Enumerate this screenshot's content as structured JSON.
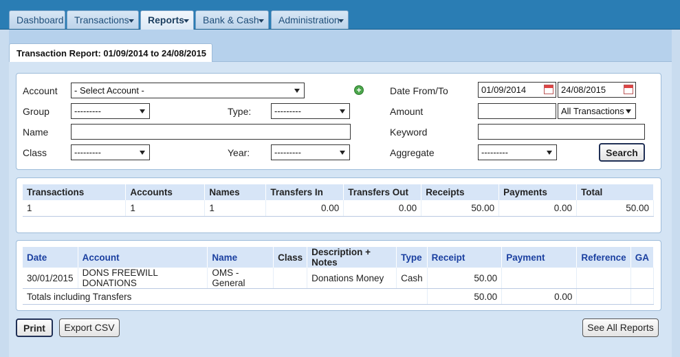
{
  "nav": {
    "tabs": [
      {
        "label": "Dashboard",
        "dropdown": false,
        "active": false
      },
      {
        "label": "Transactions",
        "dropdown": true,
        "active": false
      },
      {
        "label": "Reports",
        "dropdown": true,
        "active": true
      },
      {
        "label": "Bank & Cash",
        "dropdown": true,
        "active": false
      },
      {
        "label": "Administration",
        "dropdown": true,
        "active": false
      }
    ]
  },
  "report_tab": {
    "title": "Transaction Report: 01/09/2014 to 24/08/2015"
  },
  "filters": {
    "account_label": "Account",
    "account_value": "- Select Account -",
    "group_label": "Group",
    "group_value": "---------",
    "type_label": "Type:",
    "type_value": "---------",
    "name_label": "Name",
    "name_value": "",
    "class_label": "Class",
    "class_value": "---------",
    "year_label": "Year:",
    "year_value": "---------",
    "date_label": "Date From/To",
    "date_from": "01/09/2014",
    "date_to": "24/08/2015",
    "amount_label": "Amount",
    "amount_value": "",
    "amount_filter": "All Transactions",
    "keyword_label": "Keyword",
    "keyword_value": "",
    "aggregate_label": "Aggregate",
    "aggregate_value": "---------",
    "search_button": "Search"
  },
  "summary": {
    "headers": [
      "Transactions",
      "Accounts",
      "Names",
      "Transfers In",
      "Transfers Out",
      "Receipts",
      "Payments",
      "Total"
    ],
    "row": [
      "1",
      "1",
      "1",
      "0.00",
      "0.00",
      "50.00",
      "0.00",
      "50.00"
    ]
  },
  "detail": {
    "headers": [
      "Date",
      "Account",
      "Name",
      "Class",
      "Description + Notes",
      "Type",
      "Receipt",
      "Payment",
      "Reference",
      "GA"
    ],
    "rows": [
      [
        "30/01/2015",
        "DONS FREEWILL DONATIONS",
        "OMS - General",
        "",
        "Donations Money",
        "Cash",
        "50.00",
        "",
        "",
        ""
      ]
    ],
    "totals_label": "Totals including Transfers",
    "totals_receipt": "50.00",
    "totals_payment": "0.00"
  },
  "footer": {
    "print_button": "Print",
    "export_button": "Export CSV",
    "see_all_button": "See All Reports"
  },
  "colors": {
    "topbar": "#2a7db4",
    "header_fill": "#d7e5f7",
    "link_blue": "#1a3fa0"
  }
}
